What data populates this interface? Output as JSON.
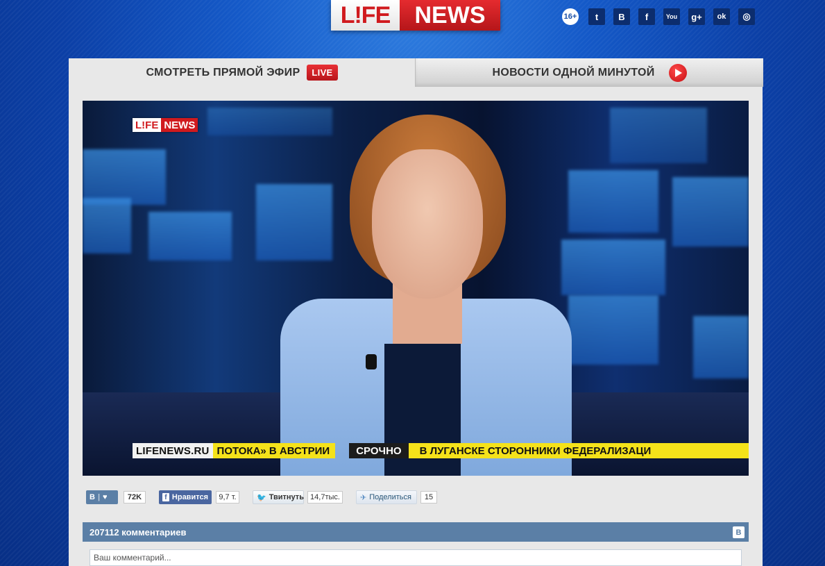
{
  "header": {
    "logo_life": "L!FE",
    "logo_news": "NEWS",
    "age_rating": "16+",
    "social_icons": [
      {
        "name": "twitter-icon",
        "glyph": "t"
      },
      {
        "name": "vk-icon",
        "glyph": "B"
      },
      {
        "name": "facebook-icon",
        "glyph": "f"
      },
      {
        "name": "youtube-icon",
        "glyph": "You"
      },
      {
        "name": "google-plus-icon",
        "glyph": "g+"
      },
      {
        "name": "odnoklassniki-icon",
        "glyph": "ok"
      },
      {
        "name": "instagram-icon",
        "glyph": "◎"
      }
    ]
  },
  "tabs": {
    "live_label": "СМОТРЕТЬ ПРЯМОЙ ЭФИР",
    "live_badge": "LIVE",
    "minute_label": "НОВОСТИ ОДНОЙ МИНУТОЙ"
  },
  "video": {
    "logo_life": "L!FE",
    "logo_news": "NEWS",
    "ticker_site": "LIFENEWS.RU",
    "ticker_text1": "ПОТОКА» В АВСТРИИ",
    "ticker_breaking": "СРОЧНО",
    "ticker_text2": "В ЛУГАНСКЕ СТОРОННИКИ ФЕДЕРАЛИЗАЦИ"
  },
  "share": {
    "vk_label": "В",
    "vk_count": "72K",
    "fb_label": "Нравится",
    "fb_count": "9,7 т.",
    "tw_label": "Твитнуть",
    "tw_count": "14,7тыс.",
    "sh_label": "Поделиться",
    "sh_count": "15"
  },
  "comments": {
    "title": "207112 комментариев",
    "vk_badge": "В",
    "placeholder": "Ваш комментарий..."
  },
  "colors": {
    "brand_red": "#d01a1e",
    "vk_blue": "#5b7fa6",
    "ticker_yellow": "#f5e21a"
  }
}
